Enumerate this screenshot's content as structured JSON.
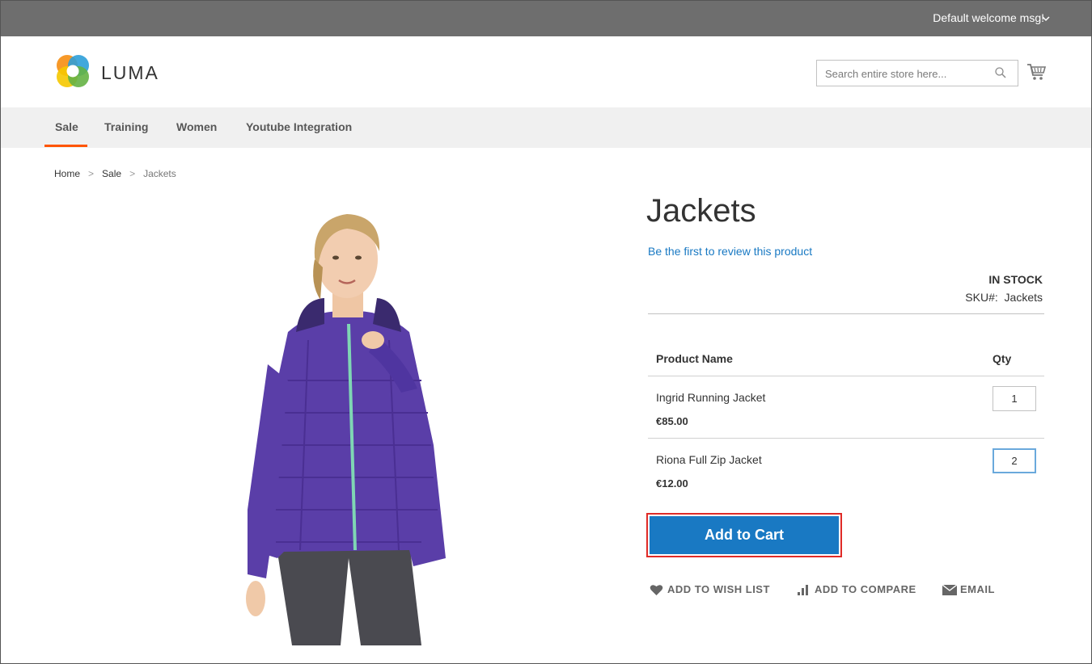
{
  "topbar": {
    "welcome": "Default welcome msg!",
    "chevron": "⌄"
  },
  "header": {
    "logo_text": "LUMA",
    "search_placeholder": "Search entire store here...",
    "icons": [
      "search-icon",
      "cart-icon"
    ]
  },
  "nav": {
    "items": [
      "Sale",
      "Training",
      "Women",
      "Youtube Integration"
    ],
    "active": "Sale"
  },
  "breadcrumb": {
    "items": [
      "Home",
      "Sale",
      "Jackets"
    ],
    "separator": ">"
  },
  "product": {
    "title": "Jackets",
    "review_link": "Be the first to review this product",
    "stock": "IN STOCK",
    "sku_label": "SKU#:",
    "sku_value": "Jackets",
    "table": {
      "headers": {
        "name": "Product Name",
        "qty": "Qty"
      },
      "rows": [
        {
          "name": "Ingrid Running Jacket",
          "price": "€85.00",
          "qty": "1"
        },
        {
          "name": "Riona Full Zip Jacket",
          "price": "€12.00",
          "qty": "2"
        }
      ]
    },
    "add_to_cart": "Add to Cart",
    "actions": {
      "wishlist": "ADD TO WISH LIST",
      "compare": "ADD TO COMPARE",
      "email": "EMAIL"
    }
  },
  "colors": {
    "topbar": "#6e6e6e",
    "nav_bg": "#f0f0f0",
    "nav_active": "#ff5501",
    "link": "#1979c3",
    "button": "#1979c3",
    "highlight_outline": "#e02b27"
  }
}
